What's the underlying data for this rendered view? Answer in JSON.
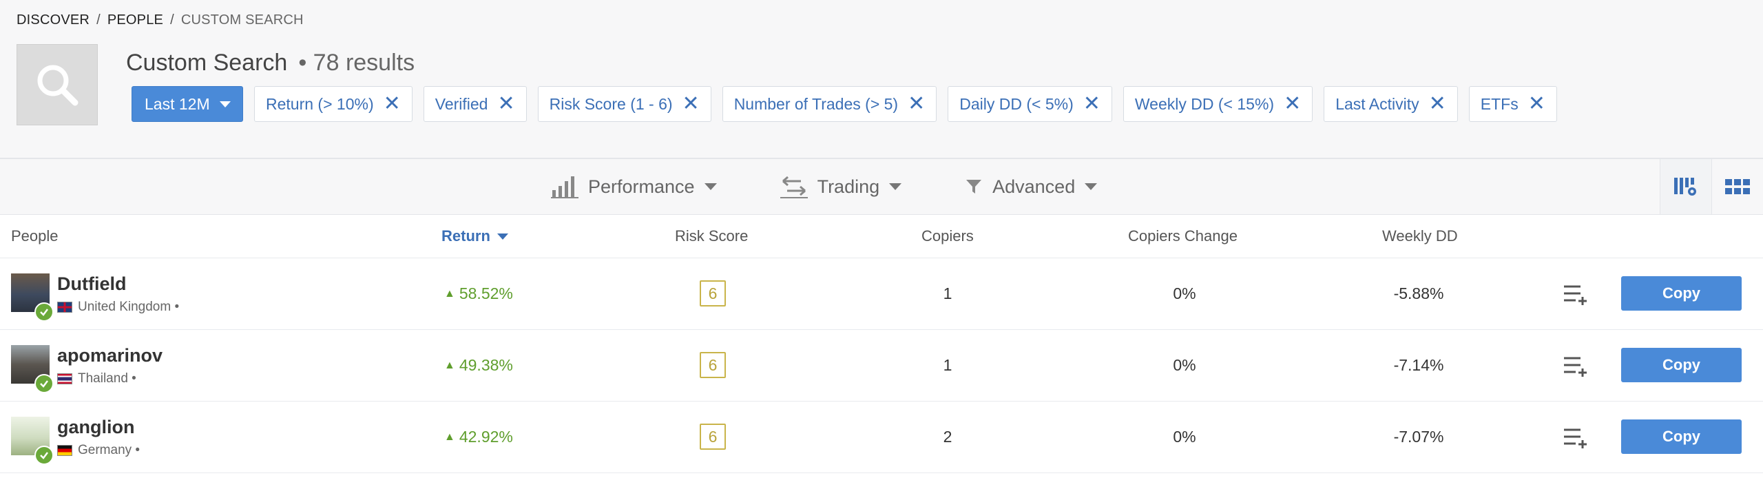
{
  "breadcrumb": {
    "items": [
      "DISCOVER",
      "PEOPLE"
    ],
    "current": "CUSTOM SEARCH",
    "separator": "/"
  },
  "header": {
    "title": "Custom Search",
    "results": "• 78 results"
  },
  "filters": {
    "period_label": "Last 12M",
    "chips": [
      {
        "label": "Return (> 10%)"
      },
      {
        "label": "Verified"
      },
      {
        "label": "Risk Score (1 - 6)"
      },
      {
        "label": "Number of Trades (> 5)"
      },
      {
        "label": "Daily DD (< 5%)"
      },
      {
        "label": "Weekly DD (< 15%)"
      },
      {
        "label": "Last Activity"
      },
      {
        "label": "ETFs"
      }
    ]
  },
  "toolbar": {
    "performance": "Performance",
    "trading": "Trading",
    "advanced": "Advanced"
  },
  "table": {
    "columns": {
      "people": "People",
      "return": "Return",
      "risk_score": "Risk Score",
      "copiers": "Copiers",
      "copiers_change": "Copiers Change",
      "weekly_dd": "Weekly DD"
    },
    "rows": [
      {
        "name": "Dutfield",
        "country": "United Kingdom •",
        "return": "58.52%",
        "risk": "6",
        "copiers": "1",
        "copiers_change": "0%",
        "weekly_dd": "-5.88%",
        "copy": "Copy"
      },
      {
        "name": "apomarinov",
        "country": "Thailand •",
        "return": "49.38%",
        "risk": "6",
        "copiers": "1",
        "copiers_change": "0%",
        "weekly_dd": "-7.14%",
        "copy": "Copy"
      },
      {
        "name": "ganglion",
        "country": "Germany •",
        "return": "42.92%",
        "risk": "6",
        "copiers": "2",
        "copiers_change": "0%",
        "weekly_dd": "-7.07%",
        "copy": "Copy"
      }
    ]
  },
  "colors": {
    "accent": "#4a8ad8",
    "link": "#3b6fb6",
    "positive": "#5f9e2d",
    "risk": "#c9b44a",
    "verified": "#6aa939"
  },
  "icons": [
    "search-icon",
    "bar-chart-icon",
    "swap-arrows-icon",
    "filter-funnel-icon",
    "grid-settings-icon",
    "grid-view-icon",
    "arrow-up-icon",
    "add-to-watchlist-icon",
    "verified-check-icon",
    "remove-filter-icon"
  ]
}
